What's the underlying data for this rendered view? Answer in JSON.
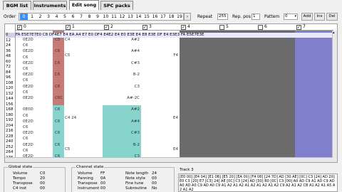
{
  "tabs": [
    "BGM list",
    "Instruments",
    "Edit song",
    "SPC packs"
  ],
  "order": {
    "label": "Order",
    "numbers": [
      "0",
      "1",
      "2",
      "3",
      "4",
      "5",
      "6",
      "7",
      "8",
      "9",
      "10",
      "11",
      "12",
      "13",
      "14",
      "15",
      "16",
      "17",
      "18",
      "19"
    ],
    "selected": "0",
    "scroll": "›",
    "repeat_label": "Repeat",
    "repeat_value": "255",
    "reppos_label": "Rep. pos",
    "reppos_value": "1",
    "pattern_label": "Pattern",
    "pattern_value": "0",
    "add": "Add",
    "ins": "Ins",
    "del": "Del"
  },
  "channels": [
    {
      "n": "0",
      "on": true
    },
    {
      "n": "1",
      "on": true
    },
    {
      "n": "2",
      "on": true
    },
    {
      "n": "3",
      "on": true
    },
    {
      "n": "4",
      "on": true
    },
    {
      "n": "5",
      "on": false
    },
    {
      "n": "6",
      "on": false
    },
    {
      "n": "7",
      "on": true
    }
  ],
  "header_line": "FA E5E7E7E0 C8 DF4E7 E4 EA A4 E7 E0 DF4 E4E2 E4 E0 E3E E4 E8 E3E DF E4 E3E3 FA E5E7E3E",
  "row_numbers": [
    "0",
    "12",
    "24",
    "36",
    "48",
    "60",
    "72",
    "84",
    "96",
    "108",
    "120",
    "132",
    "144",
    "156",
    "168",
    "180",
    "192",
    "204",
    "216",
    "228",
    "240",
    "252",
    "264",
    "276"
  ],
  "ch0_cells": [
    [
      "0E2D",
      "C5"
    ],
    [
      "C6",
      ""
    ],
    [
      "0E2D",
      "C6"
    ],
    [
      "C6",
      ""
    ],
    [
      "0E2D",
      "C6"
    ],
    [
      "C6",
      ""
    ],
    [
      "0E2D",
      "C6"
    ],
    [
      "C6",
      ""
    ],
    [
      "0E2D",
      "C6"
    ],
    [
      "C6",
      ""
    ],
    [
      "0E2D",
      "C6C"
    ],
    [
      "",
      ""
    ],
    [
      "0E0D",
      "C6"
    ],
    [
      "C6",
      ""
    ],
    [
      "0E2D",
      "C6"
    ],
    [
      "C6",
      ""
    ],
    [
      "0E2D",
      "C6"
    ],
    [
      "C6",
      ""
    ],
    [
      "0E2D",
      "C6"
    ],
    [
      "C6",
      ""
    ],
    [
      "0E2D",
      "C6"
    ]
  ],
  "ch2_cells": [
    "A#2",
    "",
    "A#4",
    "",
    "C#3",
    "",
    "B-2",
    "",
    "C3",
    "",
    "A#-2C",
    "",
    "A#2",
    "",
    "A#4",
    "",
    "C#3",
    "",
    "B-2",
    "",
    "C3"
  ],
  "ch3_cells": [
    "",
    "",
    "F4",
    "",
    "",
    "",
    "",
    "",
    "",
    "",
    "E4",
    "",
    "",
    "",
    "E4"
  ],
  "ch1_notes": [
    "C4",
    "",
    "C5",
    "",
    "",
    "",
    "",
    "",
    "",
    "",
    "C4 24",
    "",
    "",
    "",
    "C5"
  ],
  "global": {
    "title": "Global state",
    "rows": [
      [
        "Volume",
        "C0"
      ],
      [
        "Tempo",
        "20"
      ],
      [
        "Transpose",
        "00"
      ],
      [
        "C4 inst",
        "00"
      ]
    ]
  },
  "channel": {
    "title": "Channel state",
    "rows": [
      [
        "Volume",
        "FF"
      ],
      [
        "Panning",
        "0A"
      ],
      [
        "Transpose",
        "00"
      ],
      [
        "Instrument",
        "00"
      ]
    ],
    "rows2": [
      [
        "Note length",
        "24"
      ],
      [
        "Note style",
        "00"
      ],
      [
        "Fine tune",
        "00"
      ],
      [
        "Subroutine",
        "No"
      ]
    ]
  },
  "track": {
    "title": "Track 3",
    "text": "[E0 00] [E4 04] [E1 0B] [E5 20] [EA 00] [F4 08] [24 7D] AD [30 AE] [0C] C3 [24] AD 20] E0 C3 [20] E7 [C3] 24] AE [0C] C3 [24] AD [30] B0 [0C] C3 [00] A0 AD C9 A1 AD C9 AD A0 AD A0 C9 AD A0 C9 A1 A2 A1 A2 A1 A2 A1 A2 A1 A2 C9 A2 A1 A2 CB A1 A2 A1 A5 A2 A1 A2"
  },
  "colors": {
    "gray": "#6b6b6b",
    "blue": "#7f7fcc",
    "red": "#c87a74",
    "teal": "#86d4cc",
    "selected": "#3390ff"
  }
}
